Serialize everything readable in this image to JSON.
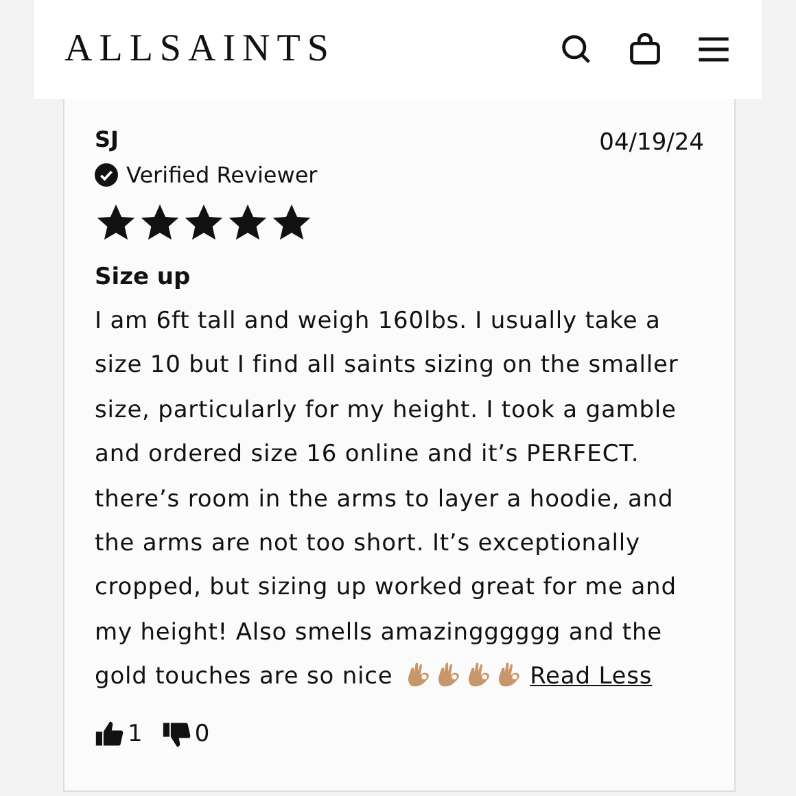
{
  "header": {
    "logo": "ALLSAINTS"
  },
  "review": {
    "author": "SJ",
    "date": "04/19/24",
    "badge": "Verified Reviewer",
    "stars": 5,
    "title": "Size up",
    "body": "I am 6ft tall and weigh 160lbs. I usually take a size 10 but I find all saints sizing on the smaller size, particularly for my height. I took a gamble and ordered size 16 online and it’s PERFECT. there’s room in the arms to layer a hoodie, and the arms are not too short. It’s exceptionally cropped, but sizing up worked great for me and my height! Also smells amazingggggg and the gold touches are so nice",
    "emojis": [
      {
        "kind": "ok-hand"
      },
      {
        "kind": "ok-hand"
      },
      {
        "kind": "ok-hand"
      },
      {
        "kind": "ok-hand"
      }
    ],
    "toggle_link": "Read Less",
    "helpful_count": "1",
    "unhelpful_count": "0"
  }
}
